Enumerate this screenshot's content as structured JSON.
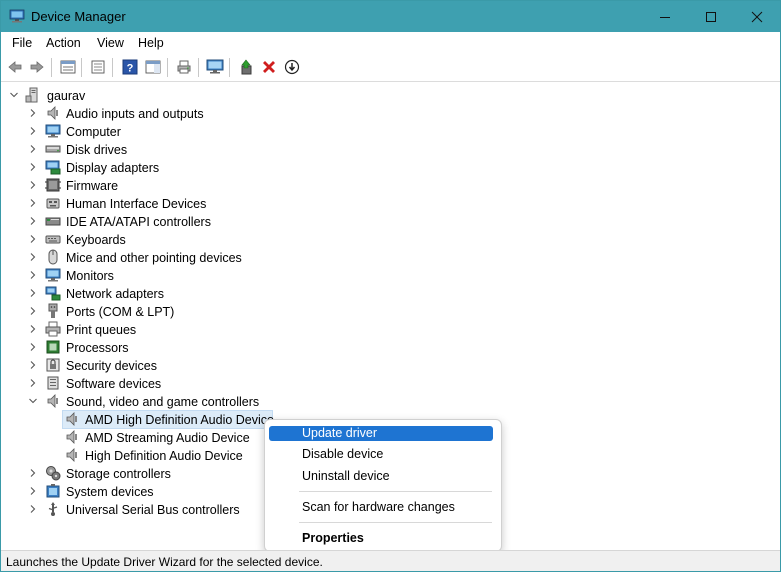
{
  "window": {
    "title": "Device Manager",
    "accent": "#3ea0b0"
  },
  "menu": [
    "File",
    "Action",
    "View",
    "Help"
  ],
  "toolbar": {
    "buttons": [
      "back-icon",
      "forward-icon",
      "properties-view-icon",
      "show-hide-icon",
      "help-icon",
      "action-pane-icon",
      "print-icon",
      "monitor-icon",
      "update-driver-icon",
      "uninstall-icon",
      "disable-icon"
    ]
  },
  "tree": {
    "root": "gaurav",
    "categories": [
      {
        "label": "Audio inputs and outputs",
        "icon": "speaker-icon"
      },
      {
        "label": "Computer",
        "icon": "computer-icon"
      },
      {
        "label": "Disk drives",
        "icon": "disk-drive-icon"
      },
      {
        "label": "Display adapters",
        "icon": "display-adapter-icon"
      },
      {
        "label": "Firmware",
        "icon": "firmware-icon"
      },
      {
        "label": "Human Interface Devices",
        "icon": "hid-icon"
      },
      {
        "label": "IDE ATA/ATAPI controllers",
        "icon": "ide-controller-icon"
      },
      {
        "label": "Keyboards",
        "icon": "keyboard-icon"
      },
      {
        "label": "Mice and other pointing devices",
        "icon": "mouse-icon"
      },
      {
        "label": "Monitors",
        "icon": "monitor-icon"
      },
      {
        "label": "Network adapters",
        "icon": "network-adapter-icon"
      },
      {
        "label": "Ports (COM & LPT)",
        "icon": "port-icon"
      },
      {
        "label": "Print queues",
        "icon": "printer-icon"
      },
      {
        "label": "Processors",
        "icon": "processor-icon"
      },
      {
        "label": "Security devices",
        "icon": "security-device-icon"
      },
      {
        "label": "Software devices",
        "icon": "software-device-icon"
      },
      {
        "label": "Sound, video and game controllers",
        "icon": "speaker-icon",
        "expanded": true,
        "children": [
          "AMD High Definition Audio Device",
          "AMD Streaming Audio Device",
          "High Definition Audio Device"
        ]
      },
      {
        "label": "Storage controllers",
        "icon": "storage-controller-icon"
      },
      {
        "label": "System devices",
        "icon": "system-device-icon"
      },
      {
        "label": "Universal Serial Bus controllers",
        "icon": "usb-icon"
      }
    ]
  },
  "context_menu": {
    "items": [
      "Update driver",
      "Disable device",
      "Uninstall device",
      "Scan for hardware changes",
      "Properties"
    ],
    "highlight": "#1e74d2"
  },
  "status": "Launches the Update Driver Wizard for the selected device."
}
